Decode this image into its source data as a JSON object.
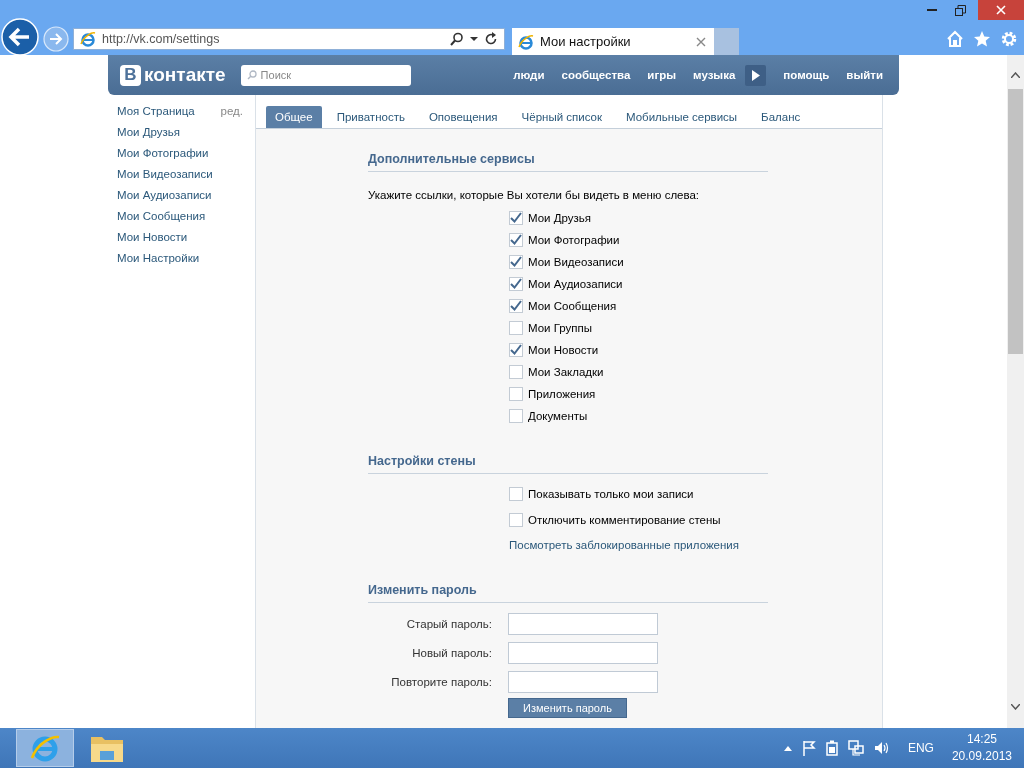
{
  "browser": {
    "address": "http://vk.com/settings",
    "tab_title": "Мои настройки"
  },
  "header": {
    "logo_mark": "В",
    "logo_text": "контакте",
    "search_placeholder": "Поиск",
    "nav": [
      {
        "kind": "link",
        "label": "люди"
      },
      {
        "kind": "link",
        "label": "сообщества"
      },
      {
        "kind": "link",
        "label": "игры"
      },
      {
        "kind": "link",
        "label": "музыка"
      },
      {
        "kind": "play"
      },
      {
        "kind": "link",
        "label": "помощь"
      },
      {
        "kind": "link",
        "label": "выйти"
      }
    ]
  },
  "sidebar": {
    "edit_label": "ред.",
    "items": [
      {
        "label": "Моя Страница"
      },
      {
        "label": "Мои Друзья"
      },
      {
        "label": "Мои Фотографии"
      },
      {
        "label": "Мои Видеозаписи"
      },
      {
        "label": "Мои Аудиозаписи"
      },
      {
        "label": "Мои Сообщения"
      },
      {
        "label": "Мои Новости"
      },
      {
        "label": "Мои Настройки"
      }
    ]
  },
  "tabs": [
    {
      "label": "Общее",
      "selected": true
    },
    {
      "label": "Приватность",
      "selected": false
    },
    {
      "label": "Оповещения",
      "selected": false
    },
    {
      "label": "Чёрный список",
      "selected": false
    },
    {
      "label": "Мобильные сервисы",
      "selected": false
    },
    {
      "label": "Баланс",
      "selected": false
    }
  ],
  "sections": [
    {
      "kind": "checklist",
      "title": "Дополнительные сервисы",
      "prompt": "Укажите ссылки, которые Вы хотели бы видеть в меню слева:",
      "items": [
        {
          "label": "Мои Друзья",
          "checked": true
        },
        {
          "label": "Мои Фотографии",
          "checked": true
        },
        {
          "label": "Мои Видеозаписи",
          "checked": true
        },
        {
          "label": "Мои Аудиозаписи",
          "checked": true
        },
        {
          "label": "Мои Сообщения",
          "checked": true
        },
        {
          "label": "Мои Группы",
          "checked": false
        },
        {
          "label": "Мои Новости",
          "checked": true
        },
        {
          "label": "Мои Закладки",
          "checked": false
        },
        {
          "label": "Приложения",
          "checked": false
        },
        {
          "label": "Документы",
          "checked": false
        }
      ]
    },
    {
      "kind": "wall",
      "title": "Настройки стены",
      "items": [
        {
          "label": "Показывать только мои записи",
          "checked": false
        },
        {
          "label": "Отключить комментирование стены",
          "checked": false
        }
      ],
      "link": "Посмотреть заблокированные приложения"
    },
    {
      "kind": "password",
      "title": "Изменить пароль",
      "fields": [
        {
          "label": "Старый пароль:"
        },
        {
          "label": "Новый пароль:"
        },
        {
          "label": "Повторите пароль:"
        }
      ],
      "button": "Изменить пароль"
    }
  ],
  "taskbar": {
    "lang": "ENG",
    "time": "14:25",
    "date": "20.09.2013"
  }
}
